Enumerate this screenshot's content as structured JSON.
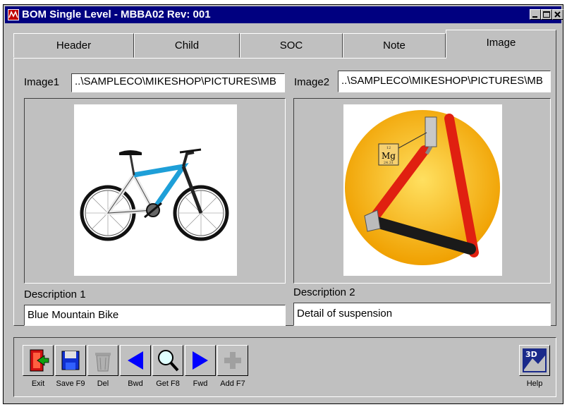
{
  "window": {
    "title": "BOM Single Level - MBBA02  Rev: 001"
  },
  "tabs": [
    {
      "label": "Header",
      "active": false
    },
    {
      "label": "Child",
      "active": false
    },
    {
      "label": "SOC",
      "active": false
    },
    {
      "label": "Note",
      "active": false
    },
    {
      "label": "Image",
      "active": true
    }
  ],
  "image1": {
    "label": "Image1",
    "path": "..\\SAMPLECO\\MIKESHOP\\PICTURES\\MB",
    "picture": "mountain-bike"
  },
  "image2": {
    "label": "Image2",
    "path": "..\\SAMPLECO\\MIKESHOP\\PICTURES\\MB",
    "picture": "suspension-detail",
    "badge_symbol": "Mg",
    "badge_number": "12",
    "badge_mass": "24.31"
  },
  "description1": {
    "label": "Description 1",
    "value": "Blue Mountain Bike"
  },
  "description2": {
    "label": "Description 2",
    "value": "Detail of suspension"
  },
  "toolbar": {
    "exit": "Exit",
    "save": "Save F9",
    "del": "Del",
    "bwd": "Bwd",
    "get": "Get F8",
    "fwd": "Fwd",
    "add": "Add F7",
    "help": "Help",
    "help_icon_text": "3D"
  },
  "colors": {
    "titlebar": "#000080",
    "face": "#c0c0c0",
    "arrow": "#0000ff",
    "bike_blue": "#1e9fd8",
    "frame_red": "#e02010",
    "sun": "#f5b400"
  }
}
